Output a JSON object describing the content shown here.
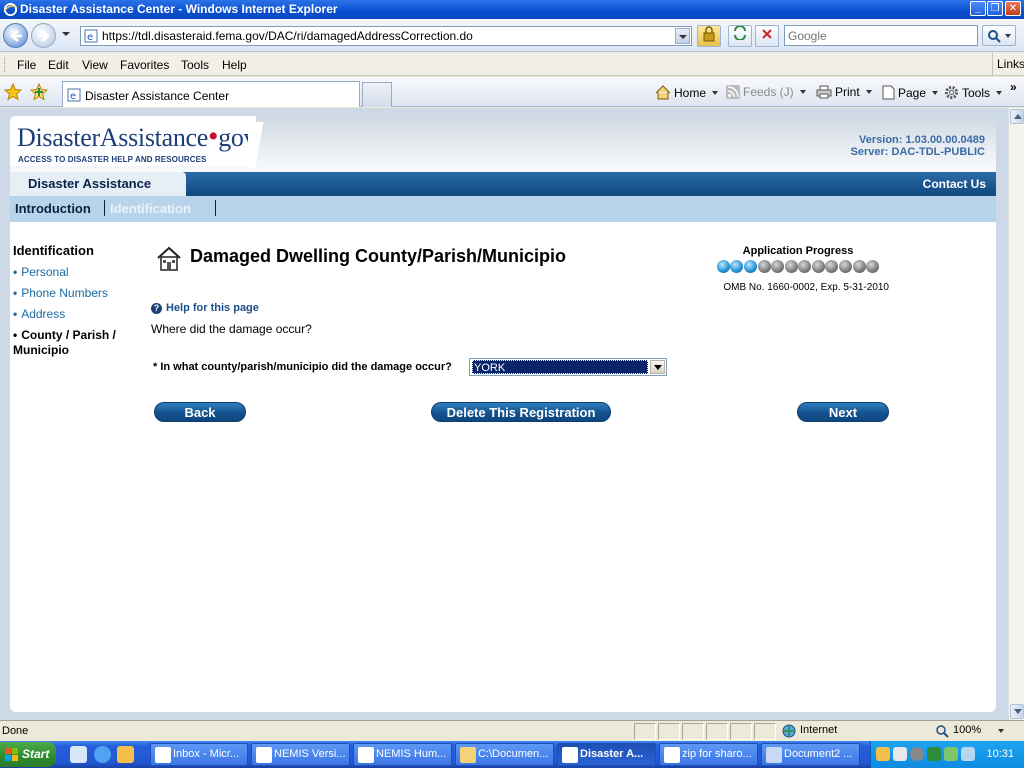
{
  "window": {
    "title": "Disaster Assistance Center - Windows Internet Explorer",
    "min_label": "_",
    "max_label": "❐",
    "close_label": "✕"
  },
  "address": {
    "url": "https://tdl.disasteraid.fema.gov/DAC/ri/damagedAddressCorrection.do",
    "search_placeholder": "Google"
  },
  "menu": {
    "items": [
      "File",
      "Edit",
      "View",
      "Favorites",
      "Tools",
      "Help"
    ],
    "links_label": "Links"
  },
  "tabs": {
    "active_label": "Disaster Assistance Center"
  },
  "commands": {
    "home": "Home",
    "feeds": "Feeds (J)",
    "print": "Print",
    "page": "Page",
    "tools": "Tools"
  },
  "site": {
    "logo_main": "DisasterAssistance",
    "logo_dot": "•",
    "logo_gov": "gov",
    "logo_tagline": "ACCESS TO DISASTER HELP AND RESOURCES",
    "version": "Version: 1.03.00.00.0489",
    "server": "Server: DAC-TDL-PUBLIC",
    "section_title": "Disaster Assistance",
    "contact": "Contact Us",
    "steps": [
      "Introduction",
      "Identification"
    ]
  },
  "leftnav": {
    "heading": "Identification",
    "items": [
      "Personal",
      "Phone Numbers",
      "Address",
      "County / Parish / Municipio"
    ],
    "bullet": "•"
  },
  "main": {
    "title": "Damaged Dwelling County/Parish/Municipio",
    "progress_label": "Application Progress",
    "progress_completed": 3,
    "progress_total": 12,
    "omb": "OMB No. 1660-0002, Exp. 5-31-2010",
    "help_icon": "?",
    "help": "Help for this page",
    "question": "Where did the damage occur?",
    "field_label": "* In what county/parish/municipio did the damage occur?",
    "selected_county": "YORK",
    "buttons": {
      "back": "Back",
      "delete": "Delete This Registration",
      "next": "Next"
    }
  },
  "status": {
    "text": "Done",
    "zone": "Internet",
    "zoom": "100%"
  },
  "taskbar": {
    "start": "Start",
    "tasks": [
      "Inbox - Micr...",
      "NEMIS Versi...",
      "NEMIS Hum...",
      "C:\\Documen...",
      "Disaster A...",
      "zip for sharo...",
      "Document2 ..."
    ],
    "active_index": 4,
    "clock": "10:31"
  },
  "colors": {
    "accent": "#14528e",
    "link": "#1c6aa0",
    "progress_done": "#1d8fd2",
    "progress_pending": "#7a7a7a"
  }
}
